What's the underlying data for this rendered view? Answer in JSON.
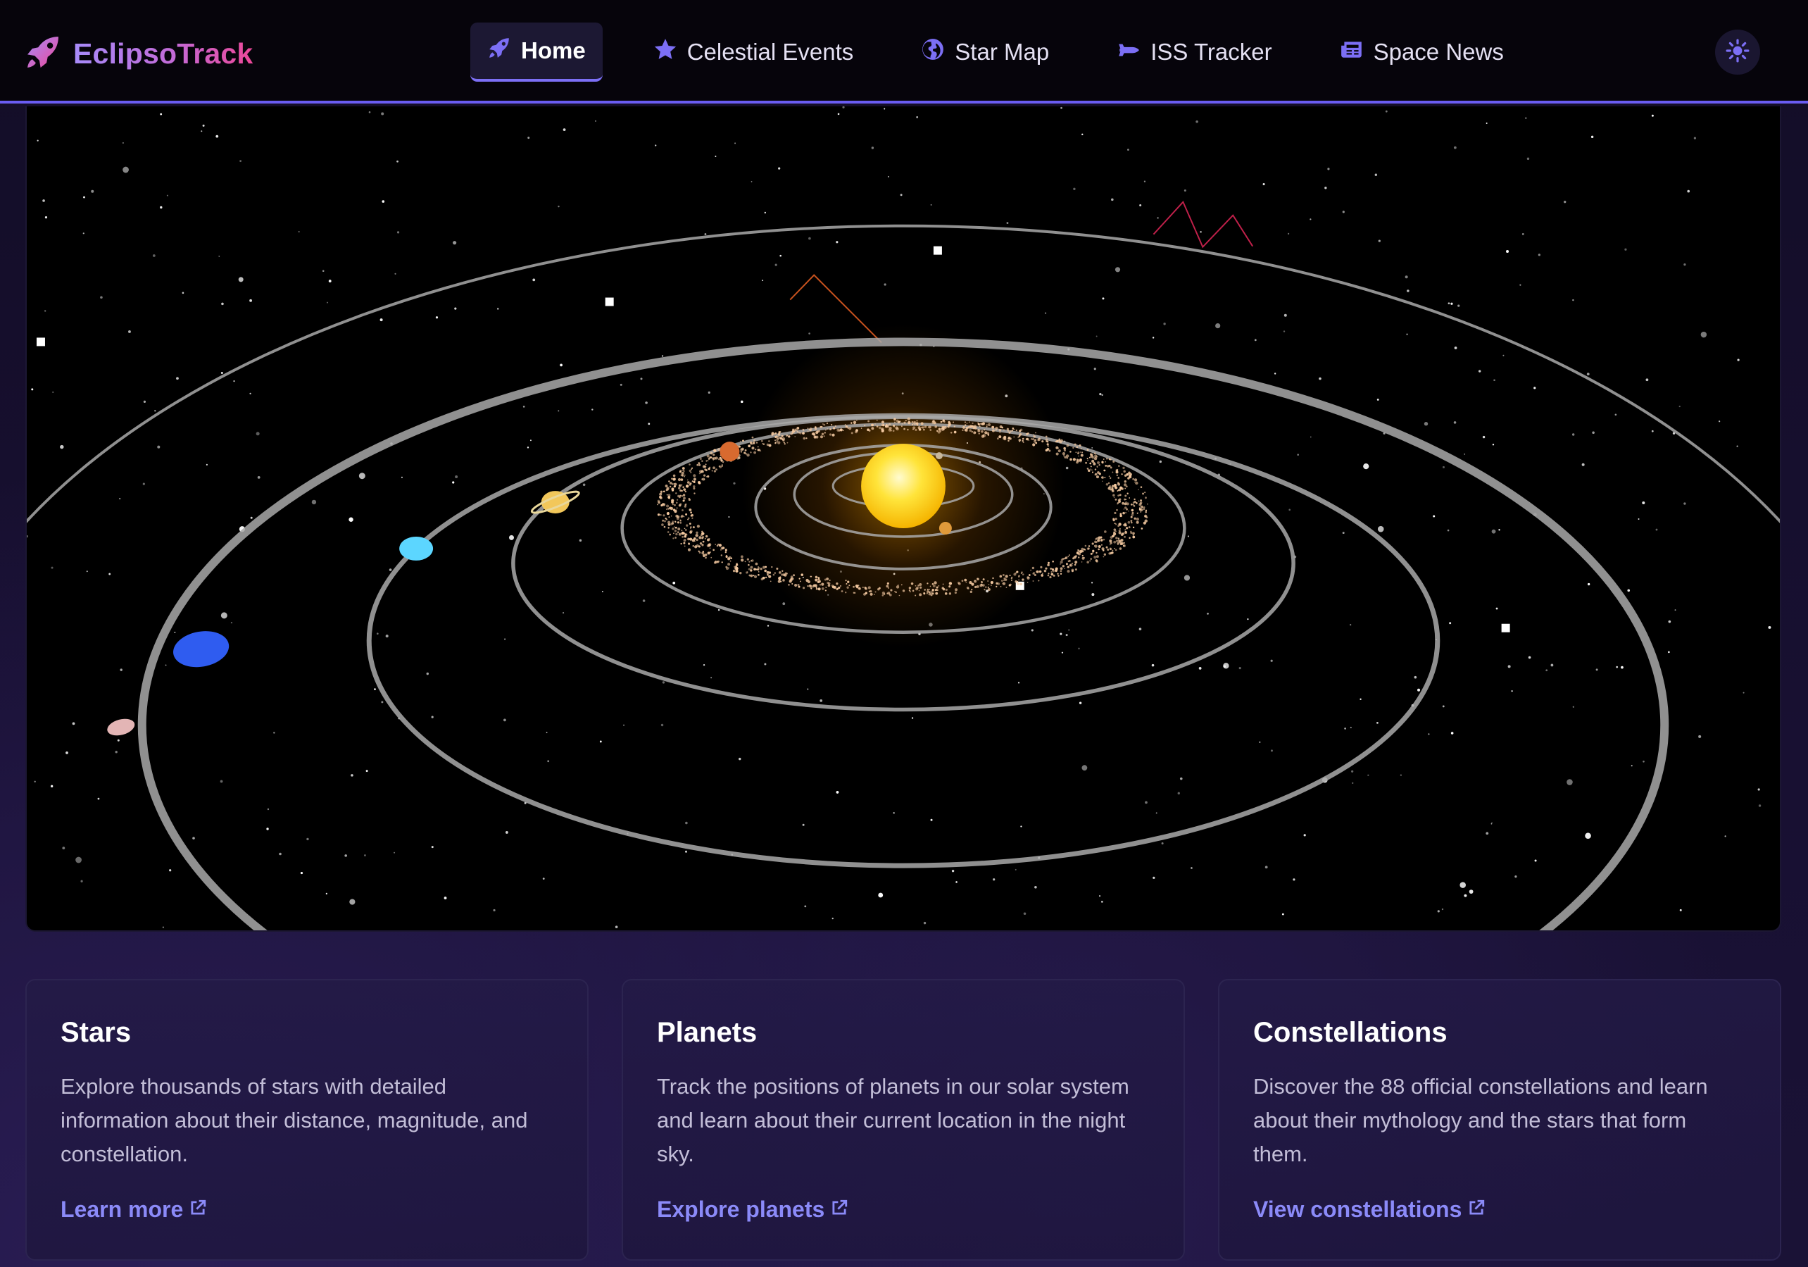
{
  "brand": {
    "name": "EclipsoTrack",
    "icon": "rocket-icon"
  },
  "nav": {
    "items": [
      {
        "label": "Home",
        "icon": "rocket-icon",
        "active": true
      },
      {
        "label": "Celestial Events",
        "icon": "star-icon",
        "active": false
      },
      {
        "label": "Star Map",
        "icon": "globe-icon",
        "active": false
      },
      {
        "label": "ISS Tracker",
        "icon": "satellite-icon",
        "active": false
      },
      {
        "label": "Space News",
        "icon": "newspaper-icon",
        "active": false
      }
    ],
    "theme_toggle_icon": "sun-icon"
  },
  "colors": {
    "accent": "#7c6ff5",
    "link": "#8b8af8",
    "brand_gradient_start": "#a78bfa",
    "brand_gradient_end": "#ec4899",
    "sun": "#ffd21a"
  },
  "cards": [
    {
      "title": "Stars",
      "text": "Explore thousands of stars with detailed information about their distance, magnitude, and constellation.",
      "link": "Learn more"
    },
    {
      "title": "Planets",
      "text": "Track the positions of planets in our solar system and learn about their current location in the night sky.",
      "link": "Explore planets"
    },
    {
      "title": "Constellations",
      "text": "Discover the 88 official constellations and learn about their mythology and the stars that form them.",
      "link": "View constellations"
    }
  ]
}
